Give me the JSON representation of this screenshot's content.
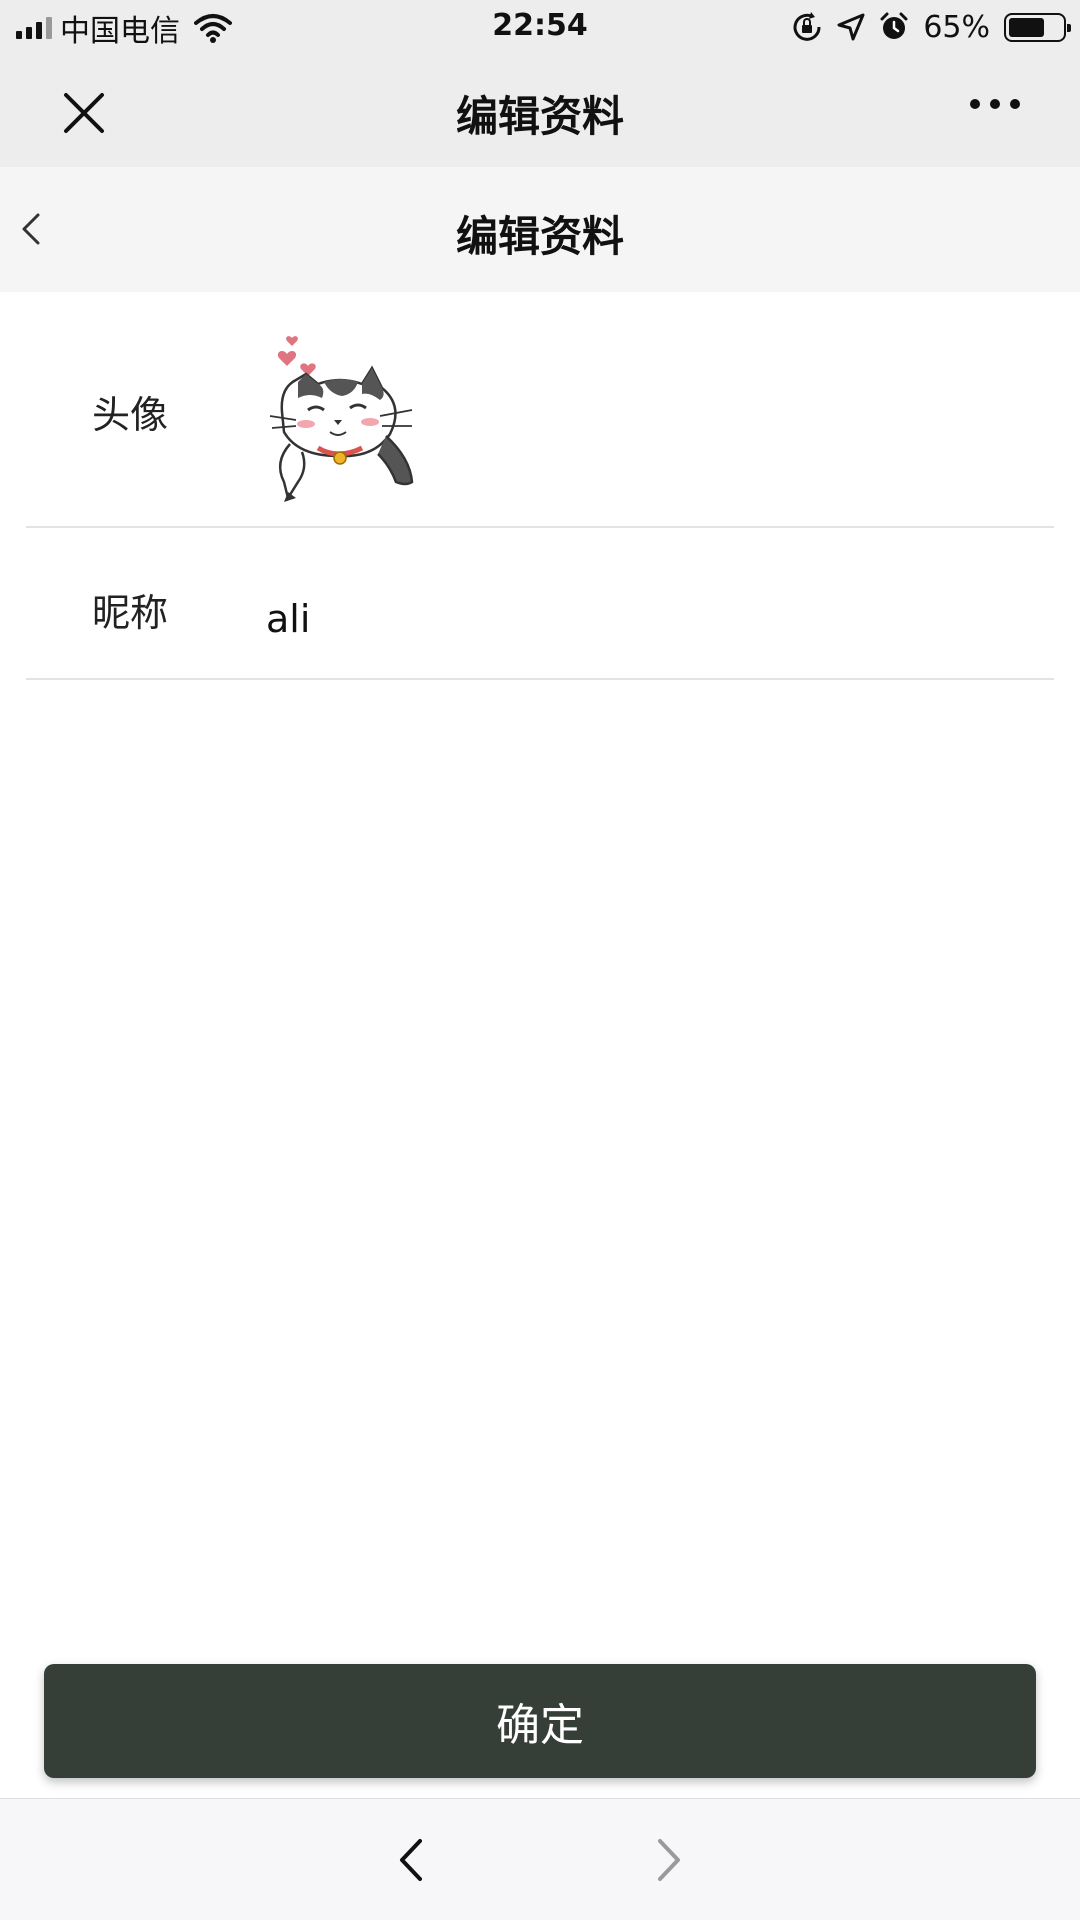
{
  "status_bar": {
    "carrier": "中国电信",
    "time": "22:54",
    "battery_percent": "65%",
    "battery_level": 0.65,
    "icons": [
      "signal-icon",
      "wifi-icon",
      "orientation-lock-icon",
      "location-icon",
      "alarm-icon",
      "battery-icon"
    ]
  },
  "nav_bar": {
    "title": "编辑资料",
    "close_icon": "close-icon",
    "more_icon": "more-icon"
  },
  "page_header": {
    "title": "编辑资料",
    "back_icon": "chevron-left-icon"
  },
  "form": {
    "avatar_label": "头像",
    "nickname_label": "昵称",
    "nickname_value": "ali"
  },
  "confirm_button": {
    "label": "确定",
    "color": "#363e38"
  },
  "bottom_bar": {
    "back_icon": "chevron-left-icon",
    "forward_icon": "chevron-right-icon"
  }
}
